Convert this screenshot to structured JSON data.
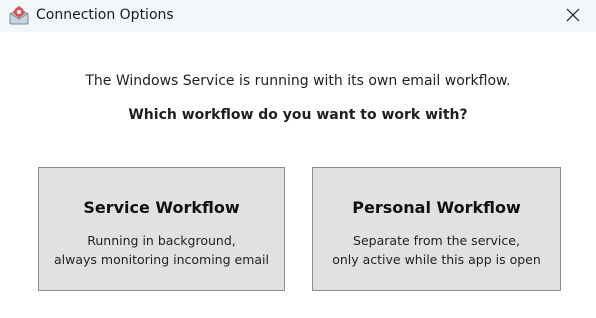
{
  "window": {
    "title": "Connection Options",
    "app_icon": "envelope-gear-icon",
    "close_icon": "close-icon"
  },
  "message": {
    "line1": "The Windows Service is running with its own email workflow.",
    "line2": "Which workflow do you want to work with?"
  },
  "options": [
    {
      "title": "Service Workflow",
      "desc_line1": "Running in background,",
      "desc_line2": "always monitoring incoming email"
    },
    {
      "title": "Personal Workflow",
      "desc_line1": "Separate from the service,",
      "desc_line2": "only active while this app is open"
    }
  ],
  "colors": {
    "titlebar_bg": "#f2f7fa",
    "button_bg": "#e1e1e1",
    "button_border": "#8c8c8c",
    "icon_accent": "#d9534f"
  }
}
